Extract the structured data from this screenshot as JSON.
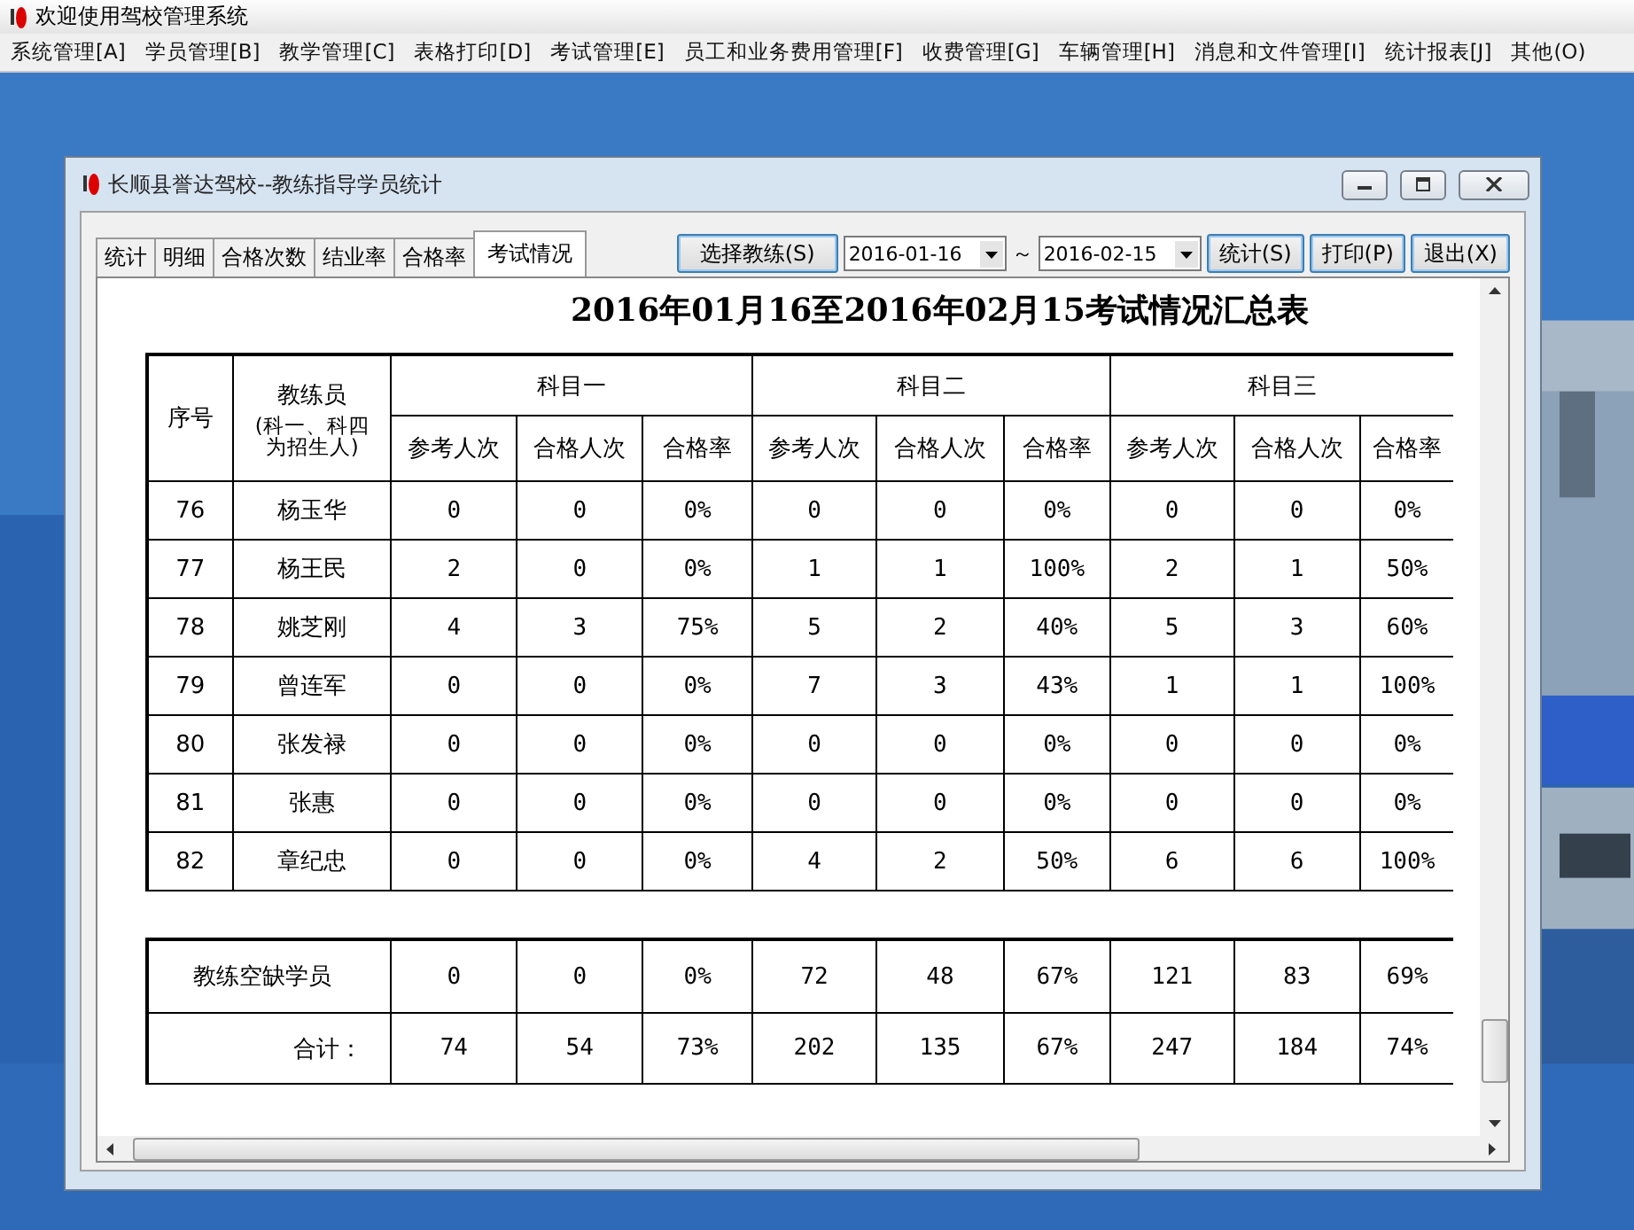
{
  "app": {
    "title": "欢迎使用驾校管理系统"
  },
  "menu": [
    "系统管理[A]",
    "学员管理[B]",
    "教学管理[C]",
    "表格打印[D]",
    "考试管理[E]",
    "员工和业务费用管理[F]",
    "收费管理[G]",
    "车辆管理[H]",
    "消息和文件管理[I]",
    "统计报表[J]",
    "其他(O)"
  ],
  "window": {
    "title": "长顺县誉达驾校--教练指导学员统计",
    "tabs": [
      {
        "label": "统计",
        "selected": false
      },
      {
        "label": "明细",
        "selected": false
      },
      {
        "label": "合格次数",
        "selected": false
      },
      {
        "label": "结业率",
        "selected": false
      },
      {
        "label": "合格率",
        "selected": false
      },
      {
        "label": "考试情况",
        "selected": true
      }
    ],
    "select_coach_button": "选择教练(S)",
    "date_from": "2016-01-16",
    "range_separator": "～",
    "date_to": "2016-02-15",
    "buttons": [
      "统计(S)",
      "打印(P)",
      "退出(X)"
    ]
  },
  "report": {
    "title": "2016年01月16至2016年02月15考试情况汇总表",
    "header": {
      "seq": "序号",
      "coach": "教练员",
      "coach_note": "(科一、科四为招生人)",
      "subjects": [
        "科目一",
        "科目二",
        "科目三"
      ],
      "subcolumns": [
        "参考人次",
        "合格人次",
        "合格率",
        "参考人次",
        "合格人次",
        "合格率",
        "参考人次",
        "合格人次",
        "合格率"
      ]
    },
    "rows": [
      {
        "seq": "76",
        "coach": "杨玉华",
        "values": [
          "0",
          "0",
          "0%",
          "0",
          "0",
          "0%",
          "0",
          "0",
          "0%"
        ]
      },
      {
        "seq": "77",
        "coach": "杨王民",
        "values": [
          "2",
          "0",
          "0%",
          "1",
          "1",
          "100%",
          "2",
          "1",
          "50%"
        ]
      },
      {
        "seq": "78",
        "coach": "姚芝刚",
        "values": [
          "4",
          "3",
          "75%",
          "5",
          "2",
          "40%",
          "5",
          "3",
          "60%"
        ]
      },
      {
        "seq": "79",
        "coach": "曾连军",
        "values": [
          "0",
          "0",
          "0%",
          "7",
          "3",
          "43%",
          "1",
          "1",
          "100%"
        ]
      },
      {
        "seq": "80",
        "coach": "张发禄",
        "values": [
          "0",
          "0",
          "0%",
          "0",
          "0",
          "0%",
          "0",
          "0",
          "0%"
        ]
      },
      {
        "seq": "81",
        "coach": "张惠",
        "values": [
          "0",
          "0",
          "0%",
          "0",
          "0",
          "0%",
          "0",
          "0",
          "0%"
        ]
      },
      {
        "seq": "82",
        "coach": "章纪忠",
        "values": [
          "0",
          "0",
          "0%",
          "4",
          "2",
          "50%",
          "6",
          "6",
          "100%"
        ]
      }
    ],
    "summary_rows": [
      {
        "kind": "gap",
        "label": "教练空缺学员",
        "values": [
          "0",
          "0",
          "0%",
          "72",
          "48",
          "67%",
          "121",
          "83",
          "69%"
        ]
      },
      {
        "kind": "total",
        "label": "合计：",
        "values": [
          "74",
          "54",
          "73%",
          "202",
          "135",
          "67%",
          "247",
          "184",
          "74%"
        ]
      }
    ]
  }
}
